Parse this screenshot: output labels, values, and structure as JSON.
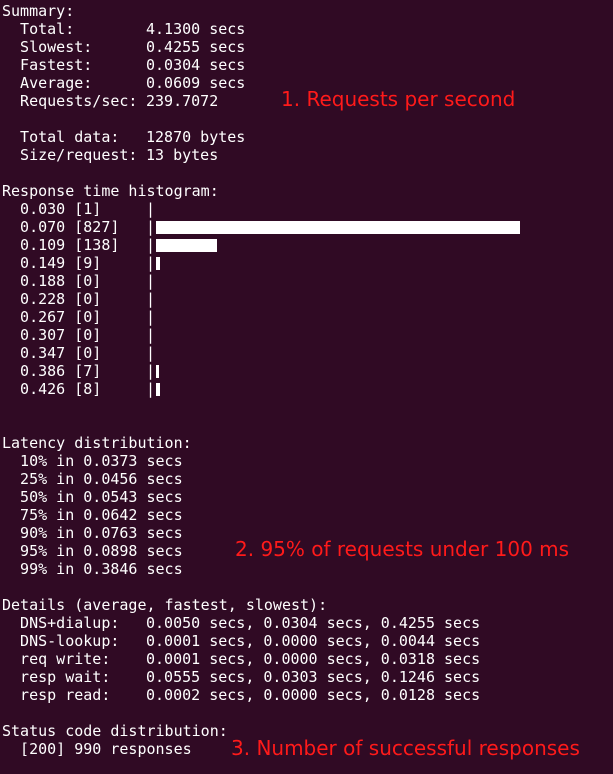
{
  "summary": {
    "heading": "Summary:",
    "total_label": "  Total:",
    "total_value": "4.1300 secs",
    "slowest_label": "  Slowest:",
    "slowest_value": "0.4255 secs",
    "fastest_label": "  Fastest:",
    "fastest_value": "0.0304 secs",
    "average_label": "  Average:",
    "average_value": "0.0609 secs",
    "rps_label": "  Requests/sec:",
    "rps_value": "239.7072",
    "total_data_label": "  Total data:",
    "total_data_value": "12870 bytes",
    "size_label": "  Size/request:",
    "size_value": "13 bytes"
  },
  "histogram": {
    "heading": "Response time histogram:",
    "rows": [
      {
        "label": "  0.030 [1]",
        "count": 1
      },
      {
        "label": "  0.070 [827]",
        "count": 827
      },
      {
        "label": "  0.109 [138]",
        "count": 138
      },
      {
        "label": "  0.149 [9]",
        "count": 9
      },
      {
        "label": "  0.188 [0]",
        "count": 0
      },
      {
        "label": "  0.228 [0]",
        "count": 0
      },
      {
        "label": "  0.267 [0]",
        "count": 0
      },
      {
        "label": "  0.307 [0]",
        "count": 0
      },
      {
        "label": "  0.347 [0]",
        "count": 0
      },
      {
        "label": "  0.386 [7]",
        "count": 7
      },
      {
        "label": "  0.426 [8]",
        "count": 8
      }
    ],
    "separator": "|"
  },
  "latency": {
    "heading": "Latency distribution:",
    "rows": [
      "  10% in 0.0373 secs",
      "  25% in 0.0456 secs",
      "  50% in 0.0543 secs",
      "  75% in 0.0642 secs",
      "  90% in 0.0763 secs",
      "  95% in 0.0898 secs",
      "  99% in 0.3846 secs"
    ]
  },
  "details": {
    "heading": "Details (average, fastest, slowest):",
    "rows": [
      {
        "label": "  DNS+dialup:",
        "values": "0.0050 secs, 0.0304 secs, 0.4255 secs"
      },
      {
        "label": "  DNS-lookup:",
        "values": "0.0001 secs, 0.0000 secs, 0.0044 secs"
      },
      {
        "label": "  req write:",
        "values": "0.0001 secs, 0.0000 secs, 0.0318 secs"
      },
      {
        "label": "  resp wait:",
        "values": "0.0555 secs, 0.0303 secs, 0.1246 secs"
      },
      {
        "label": "  resp read:",
        "values": "0.0002 secs, 0.0000 secs, 0.0128 secs"
      }
    ]
  },
  "status": {
    "heading": "Status code distribution:",
    "row": "  [200] 990 responses"
  },
  "annotations": {
    "rps": "1. Requests per second",
    "p95": "2. 95% of requests under 100 ms",
    "success": "3. Number of successful responses"
  },
  "colors": {
    "background": "#300a24",
    "text": "#ffffff",
    "annotation": "#ff1a1a"
  }
}
